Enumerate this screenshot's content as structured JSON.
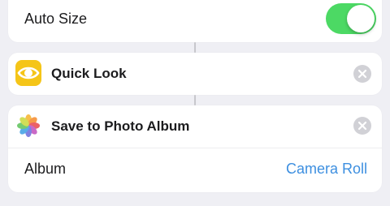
{
  "colors": {
    "toggle_on": "#4cd964",
    "link_blue": "#3d8fe0",
    "quick_look_icon_bg": "#f5c518",
    "remove_button_bg": "#d1d1d6"
  },
  "auto_size": {
    "label": "Auto Size",
    "toggle_state": "on",
    "icon": "toggle-switch"
  },
  "quick_look": {
    "title": "Quick Look",
    "icon": "eye-icon",
    "remove_icon": "close-icon"
  },
  "save_to_photo_album": {
    "title": "Save to Photo Album",
    "icon": "photos-icon",
    "remove_icon": "close-icon",
    "album_label": "Album",
    "album_value": "Camera Roll"
  }
}
